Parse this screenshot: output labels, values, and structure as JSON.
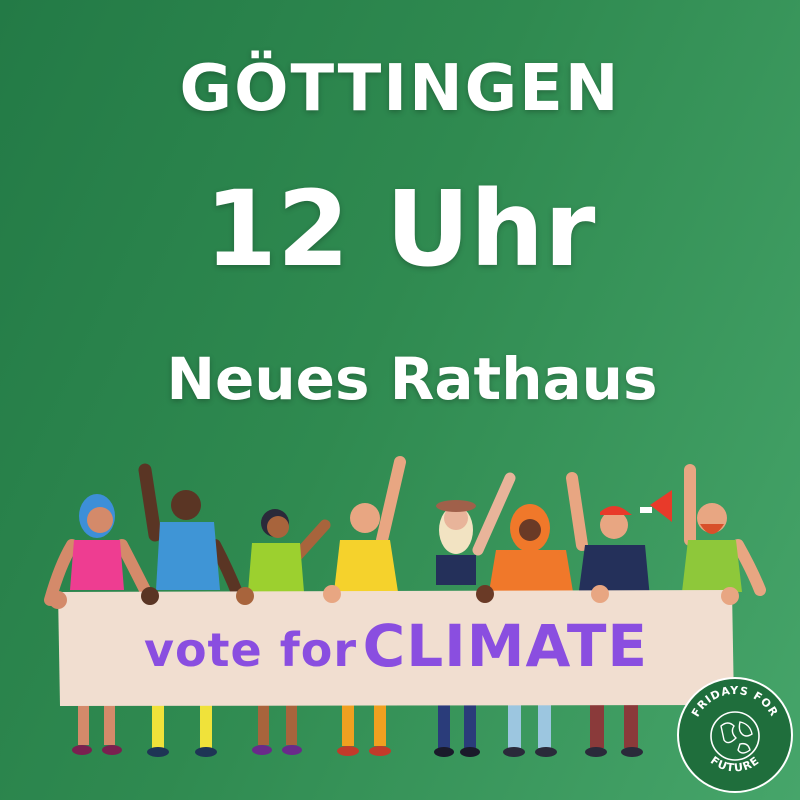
{
  "poster": {
    "city": "GÖTTINGEN",
    "time": "12 Uhr",
    "place": "Neues Rathaus"
  },
  "banner": {
    "text_vote": "vote for",
    "text_climate": "CLIMATE"
  },
  "logo": {
    "text_top": "FRIDAYS FOR",
    "text_bottom": "FUTURE",
    "icon": "globe-icon"
  },
  "colors": {
    "background": "#2f8a50",
    "headline": "#ffffff",
    "banner_fill": "#f1ded0",
    "banner_text": "#8a4ee0",
    "logo_fill": "#1f6e3c"
  }
}
